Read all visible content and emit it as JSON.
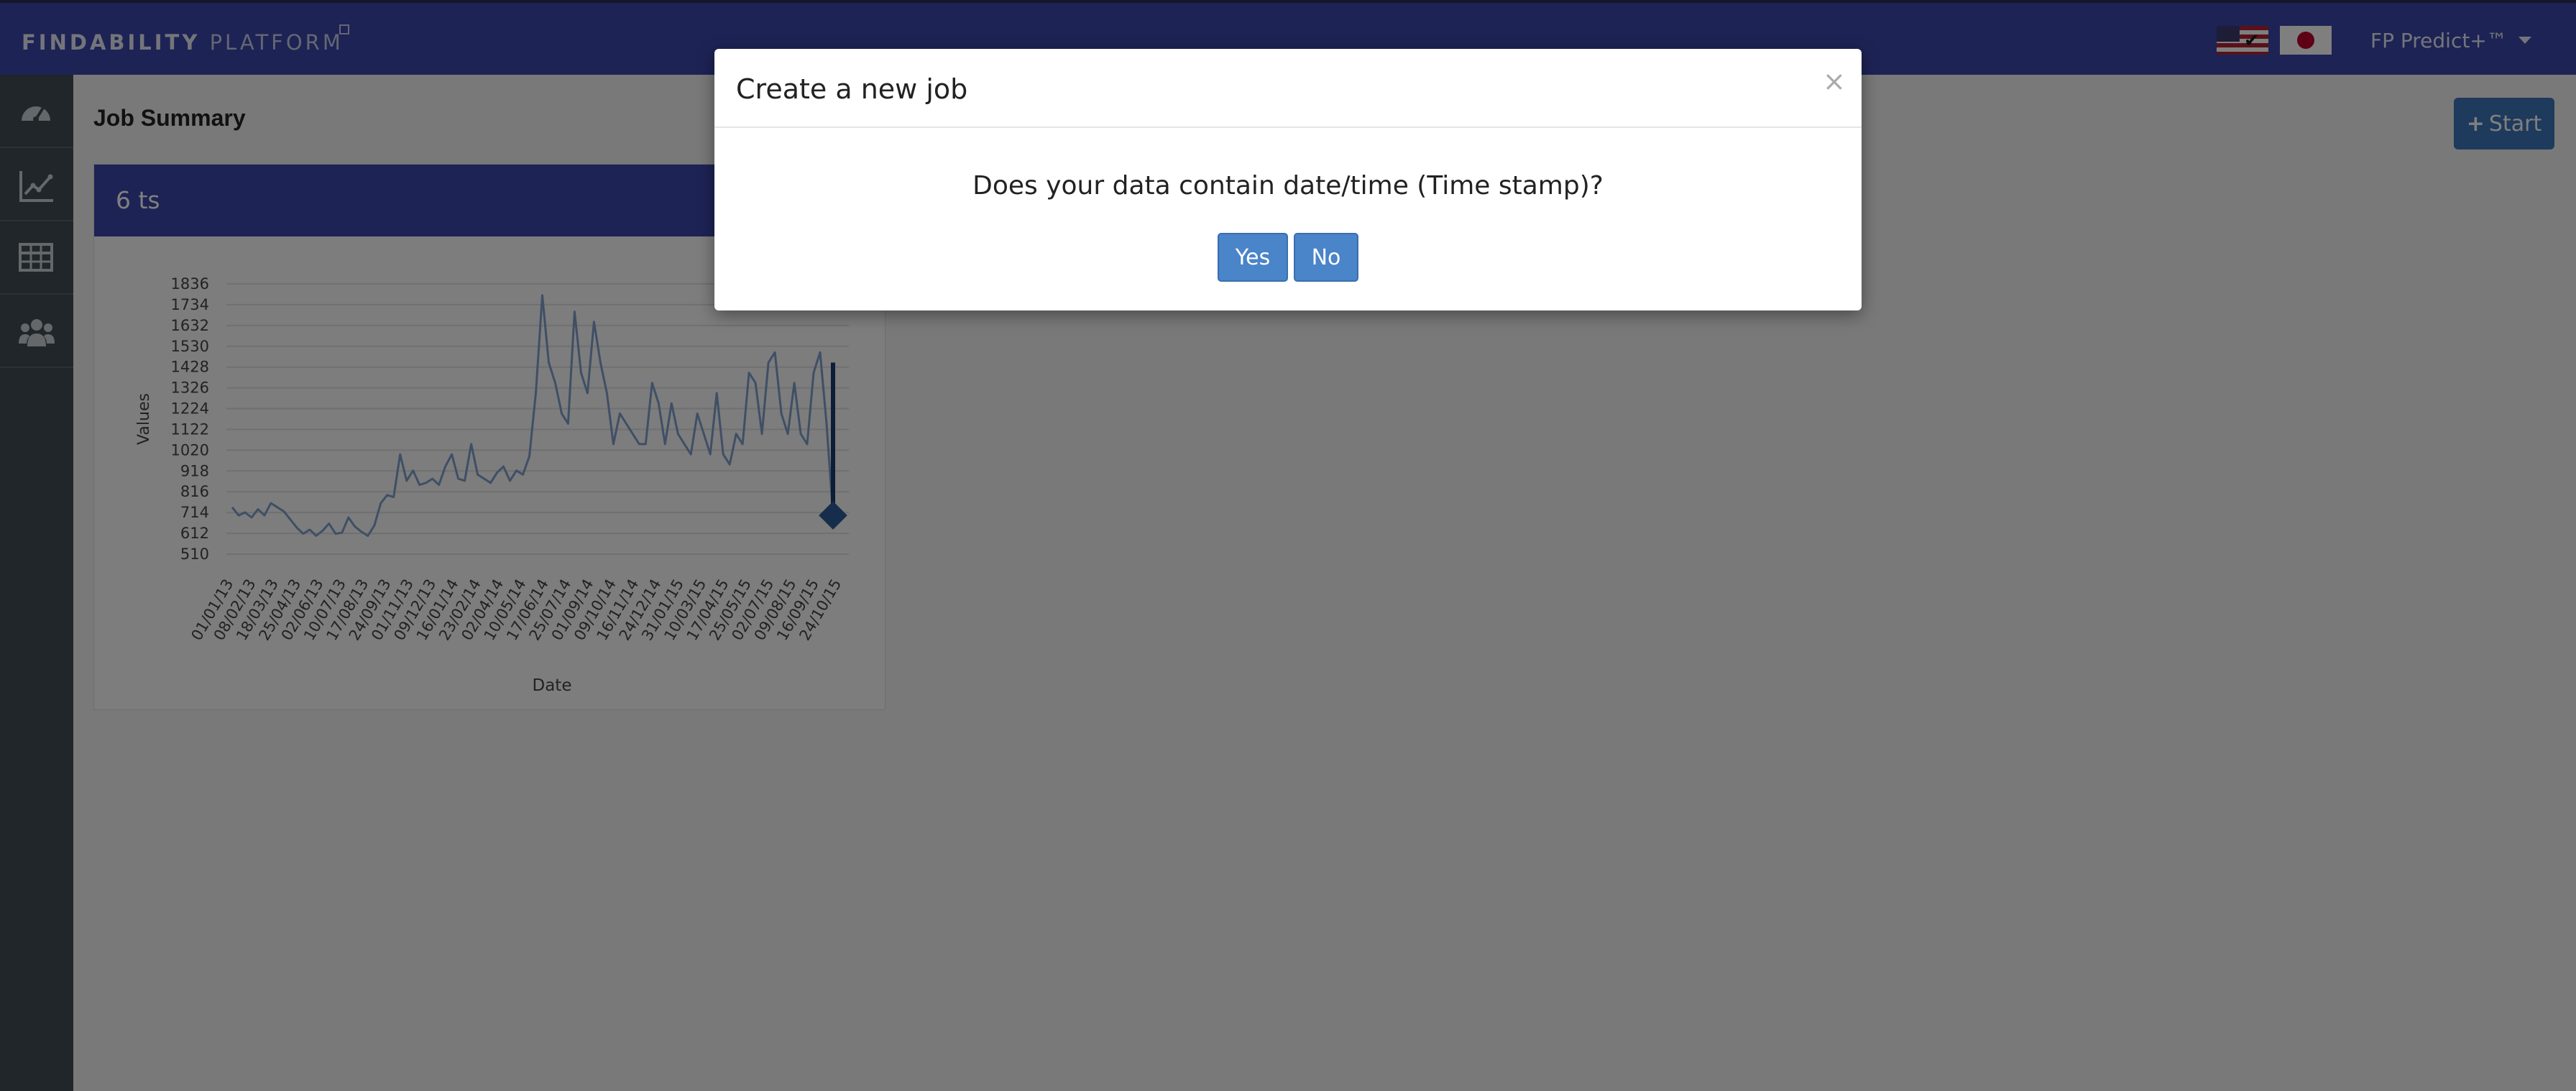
{
  "navbar": {
    "brand_bold": "FINDABILITY",
    "brand_thin": "PLATFORM",
    "user_menu": "FP Predict+™",
    "flags": [
      "us-flag-icon",
      "japan-flag-icon"
    ]
  },
  "sidebar": {
    "items": [
      {
        "icon": "dashboard-icon"
      },
      {
        "icon": "line-chart-icon"
      },
      {
        "icon": "table-icon"
      },
      {
        "icon": "users-icon"
      }
    ]
  },
  "main": {
    "title": "Job Summary",
    "start_label": "Start"
  },
  "card": {
    "title": "6 ts"
  },
  "chart_data": {
    "type": "line",
    "title": "",
    "xlabel": "Date",
    "ylabel": "Values",
    "y_ticks": [
      510,
      612,
      714,
      816,
      918,
      1020,
      1122,
      1224,
      1326,
      1428,
      1530,
      1632,
      1734,
      1836
    ],
    "ylim": [
      510,
      1836
    ],
    "x_tick_labels": [
      "01/01/13",
      "08/02/13",
      "18/03/13",
      "25/04/13",
      "02/06/13",
      "10/07/13",
      "17/08/13",
      "24/09/13",
      "01/11/13",
      "09/12/13",
      "16/01/14",
      "23/02/14",
      "02/04/14",
      "10/05/14",
      "17/06/14",
      "25/07/14",
      "01/09/14",
      "09/10/14",
      "16/11/14",
      "24/12/14",
      "31/01/15",
      "10/03/15",
      "17/04/15",
      "25/05/15",
      "02/07/15",
      "09/08/15",
      "16/09/15",
      "24/10/15"
    ],
    "series": [
      {
        "values": [
          740,
          700,
          715,
          690,
          730,
          700,
          760,
          740,
          720,
          680,
          640,
          610,
          630,
          600,
          625,
          660,
          610,
          615,
          690,
          645,
          620,
          600,
          650,
          760,
          800,
          790,
          1000,
          870,
          920,
          850,
          860,
          880,
          850,
          940,
          1000,
          880,
          870,
          1050,
          900,
          880,
          860,
          910,
          940,
          870,
          920,
          900,
          990,
          1300,
          1780,
          1450,
          1350,
          1200,
          1150,
          1700,
          1400,
          1300,
          1650,
          1450,
          1300,
          1050,
          1200,
          1150,
          1100,
          1050,
          1050,
          1350,
          1250,
          1050,
          1250,
          1100,
          1050,
          1000,
          1200,
          1100,
          1000,
          1300,
          1000,
          950,
          1100,
          1050,
          1400,
          1350,
          1100,
          1450,
          1500,
          1200,
          1100,
          1350,
          1100,
          1050,
          1400,
          1500,
          1150,
          700
        ]
      }
    ],
    "highlight_marker": "latest point"
  },
  "modal": {
    "title": "Create a new job",
    "close": "×",
    "question": "Does your data contain date/time (Time stamp)?",
    "yes_label": "Yes",
    "no_label": "No"
  }
}
